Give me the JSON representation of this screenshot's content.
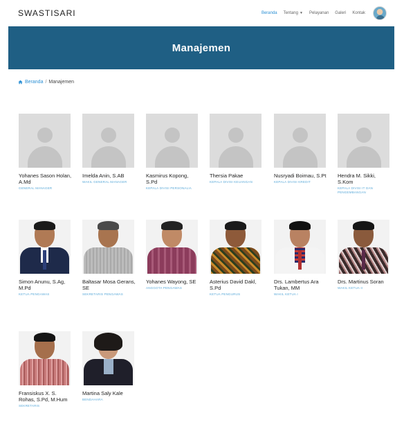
{
  "brand": "SWASTISARI",
  "nav": {
    "home": "Beranda",
    "about": "Tentang",
    "services": "Pelayanan",
    "gallery": "Galeri",
    "contact": "Kontak"
  },
  "banner_title": "Manajemen",
  "breadcrumb": {
    "home": "Beranda",
    "current": "Manajemen"
  },
  "colors": {
    "banner": "#1f5f84",
    "accent": "#2a8fd4",
    "role_text": "#5aa9d8"
  },
  "members": [
    {
      "name": "Yohanes Sason Holan, A.Md",
      "role": "GENERAL MANAGER"
    },
    {
      "name": "Imelda Anin, S.AB",
      "role": "WAKIL GENERAL MANAGER"
    },
    {
      "name": "Kasmirus Kopong, S.Pd",
      "role": "KEPALA DIVISI PERSONALIA"
    },
    {
      "name": "Thersia Pakae",
      "role": "KEPALA DIVISI KEUANGAN"
    },
    {
      "name": "Nusryadi Boimau, S.Pt",
      "role": "KEPALA DIVISI KREDIT"
    },
    {
      "name": "Hendra M. Sikki, S.Kom",
      "role": "KEPALA DIVISI IT DAN PENGEMBANGAN"
    },
    {
      "name": "Simon Anunu, S.Ag, M.Pd",
      "role": "KETUA PENGAWAS"
    },
    {
      "name": "Baltasar Mosa Gerans, SE",
      "role": "SEKRETARIS PENGAWAS"
    },
    {
      "name": "Yohanes Wayong, SE",
      "role": "ANGGOTA PENGAWAS"
    },
    {
      "name": "Asterius David Dakl, S.Pd",
      "role": "KETUA PENGURUS"
    },
    {
      "name": "Drs. Lambertus Ara Tukan, MM",
      "role": "WAKIL KETUA I"
    },
    {
      "name": "Drs. Martinus Soran",
      "role": "WAKIL KETUA II"
    },
    {
      "name": "Fransiskus X. S. Rohas, S.Pd, M.Hum",
      "role": "SEKRETARIS"
    },
    {
      "name": "Martina Saly Kale",
      "role": "BENDAHARA"
    }
  ]
}
